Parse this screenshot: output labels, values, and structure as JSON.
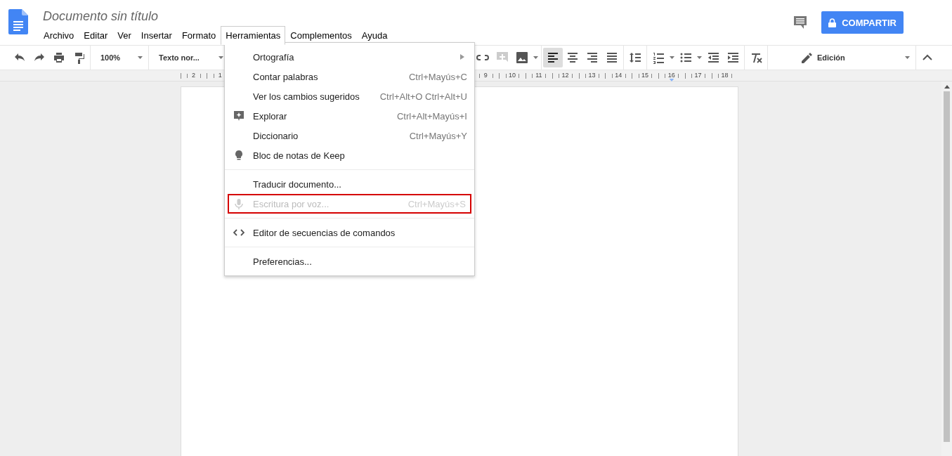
{
  "document": {
    "title": "Documento sin título"
  },
  "menu_bar": [
    {
      "label": "Archivo",
      "selected": false
    },
    {
      "label": "Editar",
      "selected": false
    },
    {
      "label": "Ver",
      "selected": false
    },
    {
      "label": "Insertar",
      "selected": false
    },
    {
      "label": "Formato",
      "selected": false
    },
    {
      "label": "Herramientas",
      "selected": true
    },
    {
      "label": "Complementos",
      "selected": false
    },
    {
      "label": "Ayuda",
      "selected": false
    }
  ],
  "share_button": {
    "label": "COMPARTIR"
  },
  "toolbar": {
    "zoom": "100%",
    "style": "Texto nor...",
    "mode": "Edición",
    "alignment": [
      {
        "kind": "left",
        "selected": true
      },
      {
        "kind": "center",
        "selected": false
      },
      {
        "kind": "right",
        "selected": false
      },
      {
        "kind": "justify",
        "selected": false
      }
    ]
  },
  "ruler": {
    "left_labels": [
      "2",
      "1"
    ],
    "right_labels": [
      "9",
      "10",
      "11",
      "12",
      "13",
      "14",
      "15",
      "16",
      "17",
      "18"
    ]
  },
  "tools_menu": {
    "sections": [
      [
        {
          "label": "Ortografía",
          "kind": "plain",
          "submenu": true,
          "disabled": false,
          "highlighted": false
        },
        {
          "label": "Contar palabras",
          "shortcut": "Ctrl+Mayús+C",
          "kind": "plain",
          "submenu": false,
          "disabled": false,
          "highlighted": false
        },
        {
          "label": "Ver los cambios sugeridos",
          "shortcut": "Ctrl+Alt+O Ctrl+Alt+U",
          "kind": "plain",
          "submenu": false,
          "disabled": false,
          "highlighted": false
        },
        {
          "label": "Explorar",
          "shortcut": "Ctrl+Alt+Mayús+I",
          "kind": "explore",
          "submenu": false,
          "disabled": false,
          "highlighted": false
        },
        {
          "label": "Diccionario",
          "shortcut": "Ctrl+Mayús+Y",
          "kind": "plain",
          "submenu": false,
          "disabled": false,
          "highlighted": false
        },
        {
          "label": "Bloc de notas de Keep",
          "kind": "keep",
          "submenu": false,
          "disabled": false,
          "highlighted": false
        }
      ],
      [
        {
          "label": "Traducir documento...",
          "kind": "plain",
          "submenu": false,
          "disabled": false,
          "highlighted": false
        },
        {
          "label": "Escritura por voz...",
          "shortcut": "Ctrl+Mayús+S",
          "kind": "voice",
          "submenu": false,
          "disabled": true,
          "highlighted": true
        }
      ],
      [
        {
          "label": "Editor de secuencias de comandos",
          "kind": "script",
          "submenu": false,
          "disabled": false,
          "highlighted": false
        }
      ],
      [
        {
          "label": "Preferencias...",
          "kind": "plain",
          "submenu": false,
          "disabled": false,
          "highlighted": false
        }
      ]
    ]
  }
}
